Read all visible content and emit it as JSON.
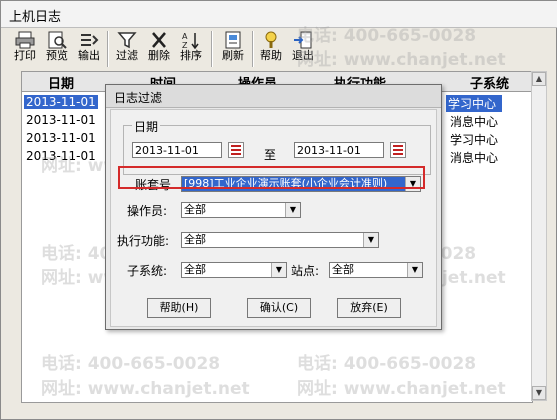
{
  "window": {
    "title": "上机日志"
  },
  "toolbar": {
    "buttons": [
      {
        "label": "打印",
        "icon": "printer-icon"
      },
      {
        "label": "预览",
        "icon": "preview-icon"
      },
      {
        "label": "输出",
        "icon": "export-icon"
      },
      {
        "label": "过滤",
        "icon": "filter-icon"
      },
      {
        "label": "删除",
        "icon": "delete-icon"
      },
      {
        "label": "排序",
        "icon": "sort-icon"
      },
      {
        "label": "刷新",
        "icon": "refresh-icon"
      },
      {
        "label": "帮助",
        "icon": "help-icon"
      },
      {
        "label": "退出",
        "icon": "exit-icon"
      }
    ]
  },
  "table": {
    "headers": [
      "日期",
      "时间",
      "操作员",
      "执行功能",
      "子系统"
    ],
    "rows": [
      {
        "date": "2013-11-01",
        "subsystem": "学习中心",
        "selected": true
      },
      {
        "date": "2013-11-01",
        "subsystem": "消息中心",
        "selected": false
      },
      {
        "date": "2013-11-01",
        "subsystem": "学习中心",
        "selected": false
      },
      {
        "date": "2013-11-01",
        "subsystem": "消息中心",
        "selected": false
      }
    ]
  },
  "dialog": {
    "title": "日志过滤",
    "date_group_label": "日期",
    "date_from": "2013-11-01",
    "date_to_label": "至",
    "date_to": "2013-11-01",
    "account_label": "账套号",
    "account_value": "[998]工业企业演示账套(小企业会计准则)",
    "operator_label": "操作员:",
    "operator_value": "全部",
    "function_label": "执行功能:",
    "function_value": "全部",
    "subsystem_label": "子系统:",
    "subsystem_value": "全部",
    "site_label": "站点:",
    "site_value": "全部",
    "help_button": "帮助(H)",
    "ok_button": "确认(C)",
    "cancel_button": "放弃(E)"
  },
  "watermarks": {
    "phone": "电话: 400-665-0028",
    "site": "网址: www.chanjet.net"
  },
  "colors": {
    "selection": "#3366cc",
    "highlight_border": "#d42a2a"
  }
}
